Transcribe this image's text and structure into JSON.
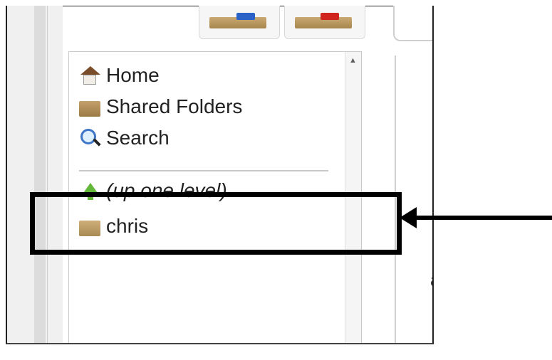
{
  "tree": {
    "nav": [
      {
        "label": "Home",
        "icon": "home-icon"
      },
      {
        "label": "Shared Folders",
        "icon": "shared-folder-icon"
      },
      {
        "label": "Search",
        "icon": "search-icon"
      }
    ],
    "folders": [
      {
        "label": "(up one level)",
        "icon": "up-arrow-icon"
      },
      {
        "label": "chris",
        "icon": "folder-icon"
      }
    ]
  },
  "right_peek": {
    "line1": "a"
  },
  "colors": {
    "annotation": "#000000",
    "folder": "#b9985f",
    "up_arrow": "#63b83a"
  }
}
